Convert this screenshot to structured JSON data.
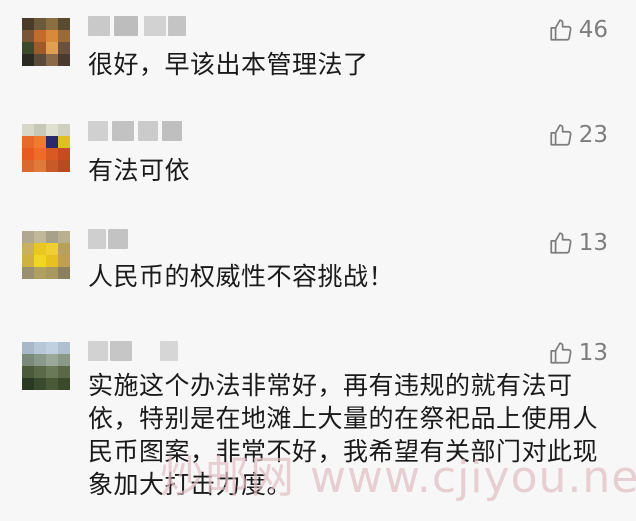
{
  "comments": [
    {
      "text": "很好，早该出本管理法了",
      "likes": "46",
      "avatar_colors": [
        "#4a3a2a",
        "#6b5a3a",
        "#8a7040",
        "#5a4a30",
        "#7a5535",
        "#c46a2a",
        "#d88a3a",
        "#9a6a3a",
        "#3a4a2a",
        "#a05a2a",
        "#e0a050",
        "#6a5040",
        "#2a2a22",
        "#5a4a3a",
        "#8a6a4a",
        "#4a3a30"
      ]
    },
    {
      "text": "有法可依",
      "likes": "23",
      "avatar_colors": [
        "#d8d8c8",
        "#c8c8b8",
        "#e0e0d0",
        "#d0d0c0",
        "#e86a2a",
        "#f07a30",
        "#2a2a6a",
        "#e0c020",
        "#e85a20",
        "#f06a28",
        "#d85a22",
        "#c84a20",
        "#d86a30",
        "#e07a3a",
        "#c85a2a",
        "#b84a22"
      ]
    },
    {
      "text": "人民币的权威性不容挑战！",
      "likes": "13",
      "avatar_colors": [
        "#b0a890",
        "#c0b898",
        "#a8a088",
        "#b8b090",
        "#c8b060",
        "#e8c820",
        "#f0d030",
        "#b8a060",
        "#d0b040",
        "#f0d820",
        "#e8c020",
        "#c0a050",
        "#9a9070",
        "#b0a060",
        "#a89860",
        "#8a8060"
      ]
    },
    {
      "text": "实施这个办法非常好，再有违规的就有法可依，特别是在地滩上大量的在祭祀品上使用人民币图案，非常不好，我希望有关部门对此现象加大打击力度。",
      "likes": "13",
      "avatar_colors": [
        "#a8b8c8",
        "#b8c8d8",
        "#c0d0e0",
        "#b0c0d0",
        "#7a8a7a",
        "#8a9a8a",
        "#9aa89a",
        "#8a9888",
        "#4a5a3a",
        "#5a6a48",
        "#6a7a58",
        "#5a6848",
        "#2a3a22",
        "#3a4a2e",
        "#4a5a38",
        "#3a4a2a"
      ]
    }
  ],
  "watermark": "炒邮网 www.cjiyou.net",
  "colors": {
    "background": "#f7f7f7",
    "text": "#1a1a1a",
    "like_icon": "#7d7d7d"
  }
}
